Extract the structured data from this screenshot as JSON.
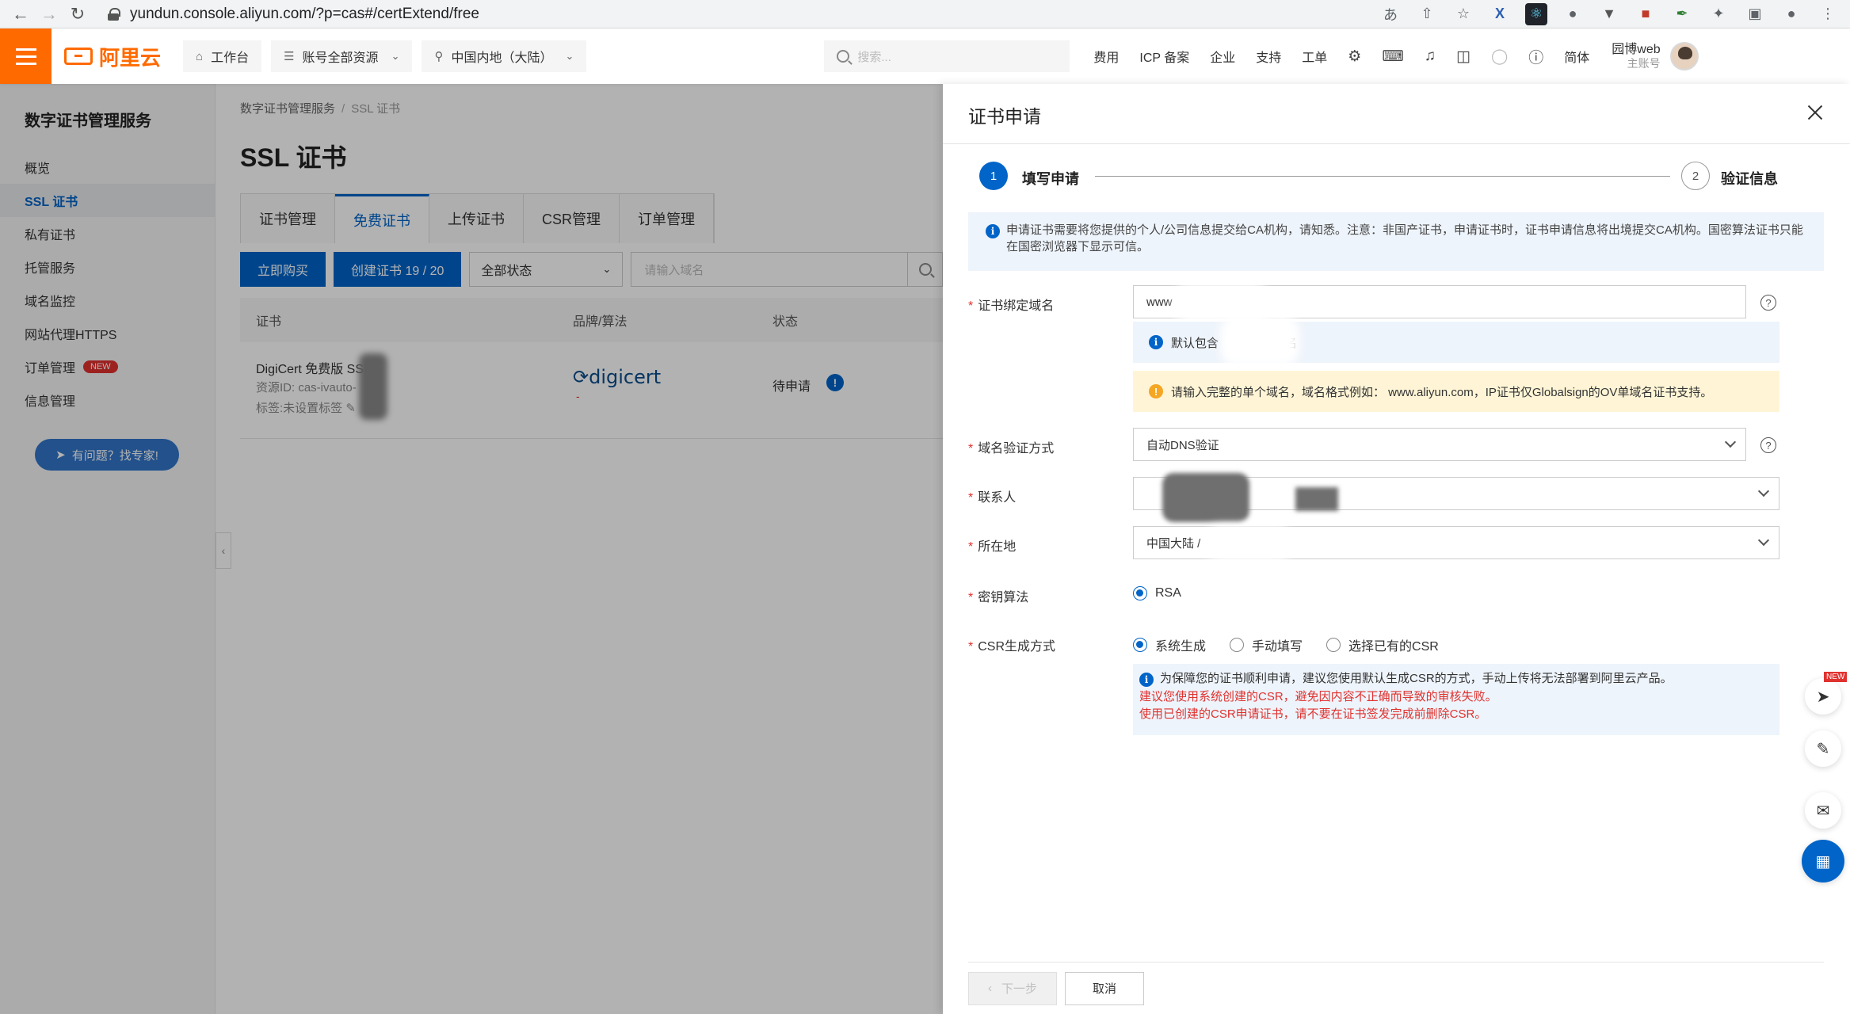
{
  "browser": {
    "url": "yundun.console.aliyun.com/?p=cas#/certExtend/free"
  },
  "topnav": {
    "logo_text": "阿里云",
    "workbench": "工作台",
    "resources": "账号全部资源",
    "region": "中国内地（大陆）",
    "search_placeholder": "搜索...",
    "links": [
      "费用",
      "ICP 备案",
      "企业",
      "支持",
      "工单"
    ],
    "lang": "简体",
    "user_name": "园博web",
    "user_sub": "主账号"
  },
  "sidebar": {
    "title": "数字证书管理服务",
    "items": [
      {
        "label": "概览"
      },
      {
        "label": "SSL 证书"
      },
      {
        "label": "私有证书"
      },
      {
        "label": "托管服务"
      },
      {
        "label": "域名监控"
      },
      {
        "label": "网站代理HTTPS"
      },
      {
        "label": "订单管理",
        "badge": "NEW"
      },
      {
        "label": "信息管理"
      }
    ],
    "expert_button": "有问题？找专家!"
  },
  "main": {
    "breadcrumb": [
      "数字证书管理服务",
      "SSL 证书"
    ],
    "title": "SSL 证书",
    "tabs": [
      "证书管理",
      "免费证书",
      "上传证书",
      "CSR管理",
      "订单管理"
    ],
    "buy_button": "立即购买",
    "create_button": "创建证书 19 / 20",
    "status_filter": "全部状态",
    "domain_placeholder": "请输入域名",
    "columns": [
      "证书",
      "品牌/算法",
      "状态"
    ],
    "row": {
      "name": "DigiCert 免费版 SSL",
      "resource_id": "资源ID: cas-ivauto-",
      "tag": "标签:未设置标签",
      "brand": "digicert",
      "brand_sub": "-",
      "status": "待申请"
    }
  },
  "drawer": {
    "title": "证书申请",
    "steps": [
      {
        "num": "1",
        "label": "填写申请"
      },
      {
        "num": "2",
        "label": "验证信息"
      }
    ],
    "info_text": "申请证书需要将您提供的个人/公司信息提交给CA机构，请知悉。注意：非国产证书，申请证书时，证书申请信息将出境提交CA机构。国密算法证书只能在国密浏览器下显示可信。",
    "domain_label": "证书绑定域名",
    "domain_value": "www",
    "domain_hint_prefix": "默认包含",
    "domain_hint_suffix": "名",
    "domain_warning": "请输入完整的单个域名，域名格式例如： www.aliyun.com，IP证书仅Globalsign的OV单域名证书支持。",
    "verify_label": "域名验证方式",
    "verify_value": "自动DNS验证",
    "contact_label": "联系人",
    "location_label": "所在地",
    "location_value": "中国大陆 / ",
    "algorithm_label": "密钥算法",
    "algorithm_value": "RSA",
    "csr_label": "CSR生成方式",
    "csr_options": [
      "系统生成",
      "手动填写",
      "选择已有的CSR"
    ],
    "csr_note_1": "为保障您的证书顺利申请，建议您使用默认生成CSR的方式，手动上传将无法部署到阿里云产品。",
    "csr_note_2": "建议您使用系统创建的CSR，避免因内容不正确而导致的审核失败。",
    "csr_note_3": "使用已创建的CSR申请证书，请不要在证书签发完成前删除CSR。",
    "next_button": "下一步",
    "cancel_button": "取消"
  },
  "float_badge": "NEW"
}
